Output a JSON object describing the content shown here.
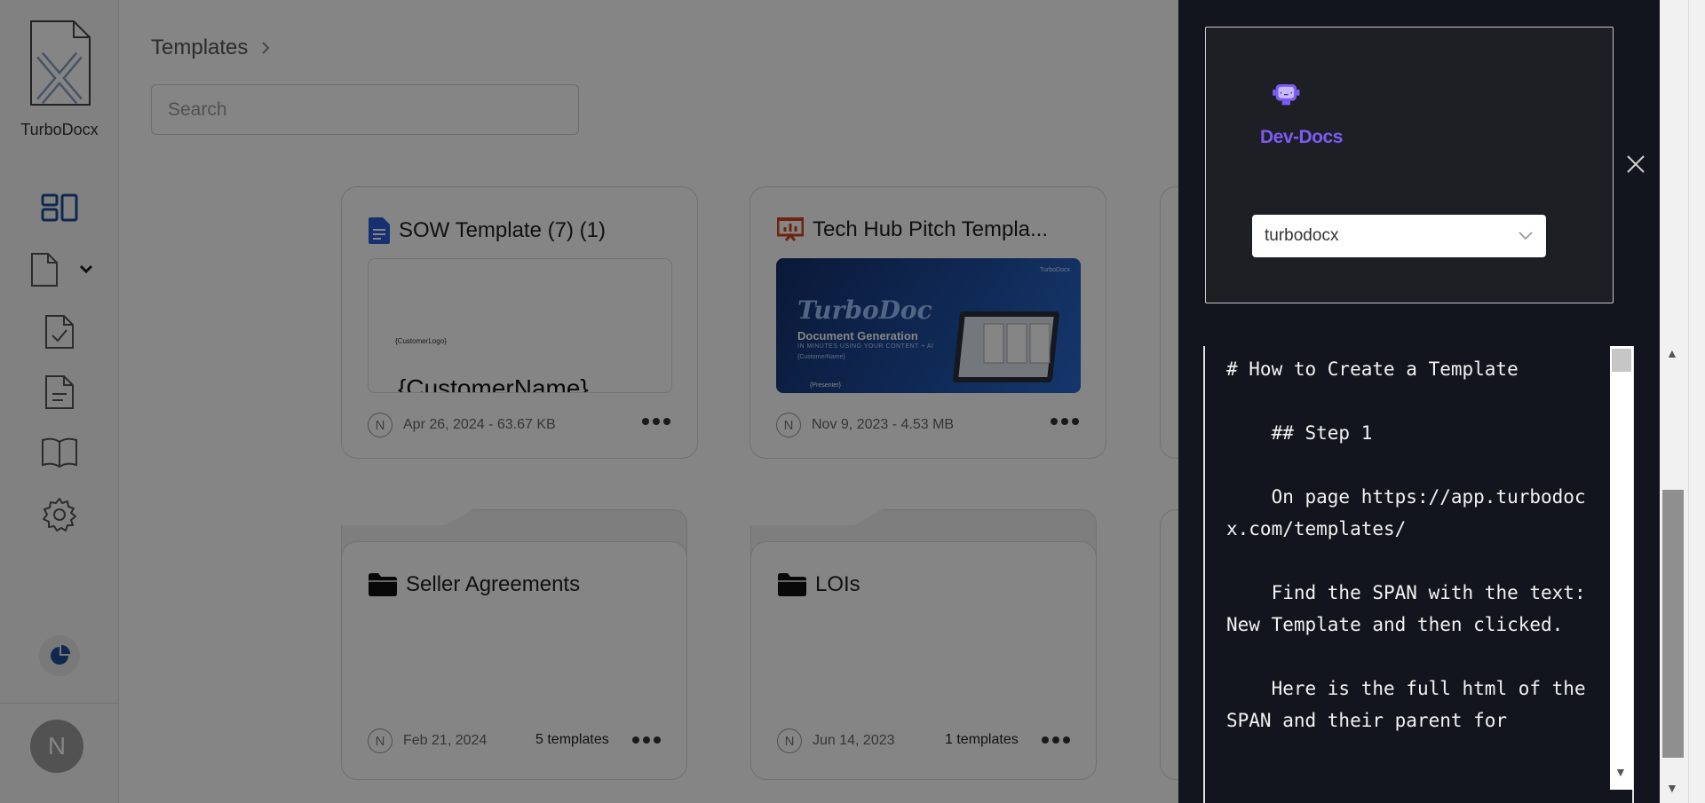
{
  "app": {
    "name": "TurboDocx"
  },
  "sidebar": {
    "user_initial": "N",
    "nav": [
      "dashboard-icon",
      "document-icon",
      "document-check-icon",
      "document-text-icon",
      "book-icon",
      "gear-icon"
    ]
  },
  "header": {
    "breadcrumb": "Templates",
    "search": {
      "placeholder": "Search",
      "value": ""
    }
  },
  "templates": [
    {
      "name": "SOW Template (7) (1)",
      "meta": "Apr 26, 2024 - 63.67 KB",
      "avatar": "N",
      "preview": {
        "logo": "{CustomerLogo}",
        "name": "{CustomerName}"
      }
    },
    {
      "name": "Tech Hub Pitch Templa...",
      "meta": "Nov 9, 2023 - 4.53 MB",
      "avatar": "N",
      "preview": {
        "title": "TurboDoc",
        "subtitle": "Document Generation",
        "tagline": "IN MINUTES USING YOUR CONTENT + AI",
        "customer": "{CustomerName}",
        "presenter": "{Presenter}",
        "brand": "TurboDocx"
      }
    }
  ],
  "folders": [
    {
      "name": "Seller Agreements",
      "date": "Feb 21, 2024",
      "count": "5 templates",
      "avatar": "N"
    },
    {
      "name": "LOIs",
      "date": "Jun 14, 2023",
      "count": "1 templates",
      "avatar": "N"
    }
  ],
  "devdocs": {
    "brand": "Dev-Docs",
    "select_value": "turbodocx",
    "content": "# How to Create a Template\n\n    ## Step 1\n\n    On page https://app.turbodocx.com/templates/\n\n    Find the SPAN with the text: New Template and then clicked.\n\n    Here is the full html of the SPAN and their parent for"
  },
  "colors": {
    "accent": "#1f4e96",
    "devdocs": "#7b5cf5",
    "panel_bg": "#12151d"
  }
}
